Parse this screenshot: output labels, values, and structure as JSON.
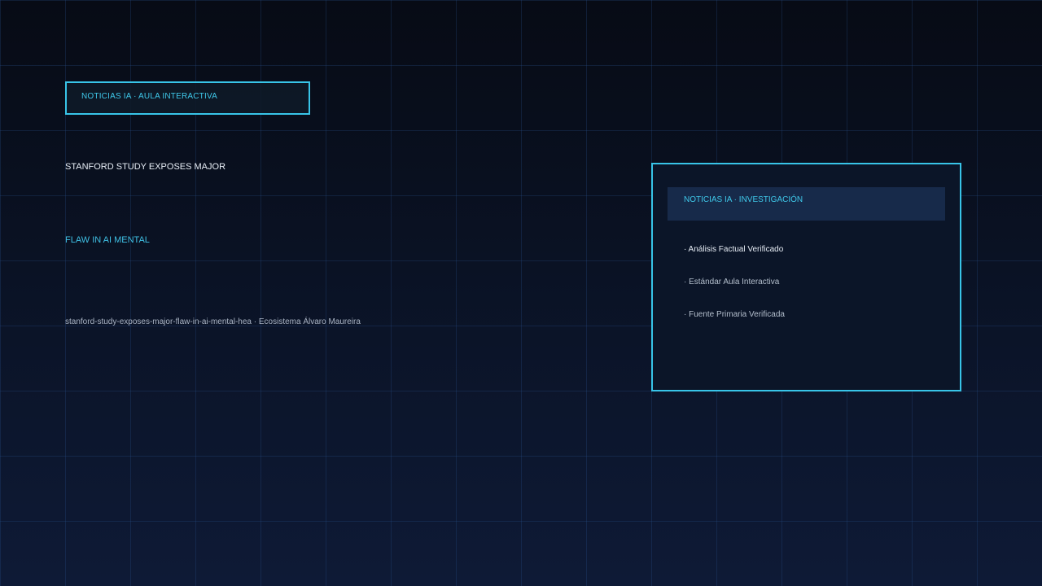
{
  "tag": {
    "label": "NOTICIAS IA · AULA INTERACTIVA"
  },
  "article": {
    "headline_line1": "STANFORD STUDY EXPOSES MAJOR",
    "headline_line2": "FLAW IN AI MENTAL",
    "slug": "stanford-study-exposes-major-flaw-in-ai-mental-hea · Ecosistema Álvaro Maureira"
  },
  "panel": {
    "header": "NOTICIAS IA · INVESTIGACIÓN",
    "items": [
      "· Análisis Factual Verificado",
      "· Estándar Aula Interactiva",
      "· Fuente Primaria Verificada"
    ]
  },
  "colors": {
    "accent": "#38c4e8",
    "background": "#0a1224",
    "panel_header": "#172a4a"
  }
}
